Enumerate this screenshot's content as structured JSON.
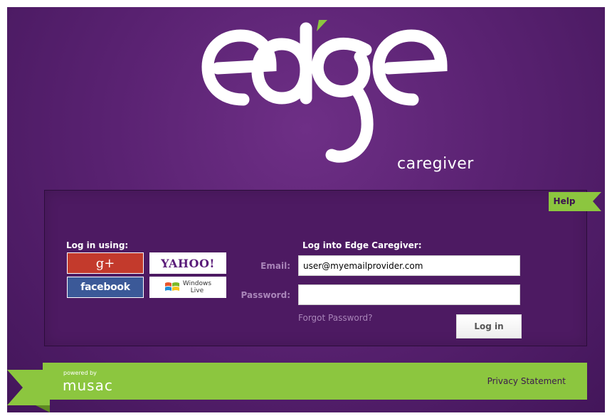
{
  "brand": {
    "logo_text": "edge",
    "tagline": "caregiver"
  },
  "help_label": "Help",
  "social": {
    "heading": "Log in using:",
    "google_label": "g+",
    "yahoo_label": "YAHOO!",
    "facebook_label": "facebook",
    "windows_line1": "Windows",
    "windows_line2": "Live"
  },
  "login": {
    "heading": "Log into Edge Caregiver:",
    "email_label": "Email:",
    "email_value": "user@myemailprovider.com",
    "password_label": "Password:",
    "password_value": "",
    "forgot_label": "Forgot Password?",
    "submit_label": "Log in"
  },
  "footer": {
    "powered_by": "powered by",
    "company": "musac",
    "privacy_label": "Privacy Statement"
  },
  "colors": {
    "background": "#5a2272",
    "panel": "#4d1a62",
    "accent_green": "#8cc63f",
    "google_red": "#c33a2c",
    "facebook_blue": "#3b5998",
    "label_lavender": "#a985b9"
  },
  "icons": {
    "windows": "windows-flag-icon"
  }
}
